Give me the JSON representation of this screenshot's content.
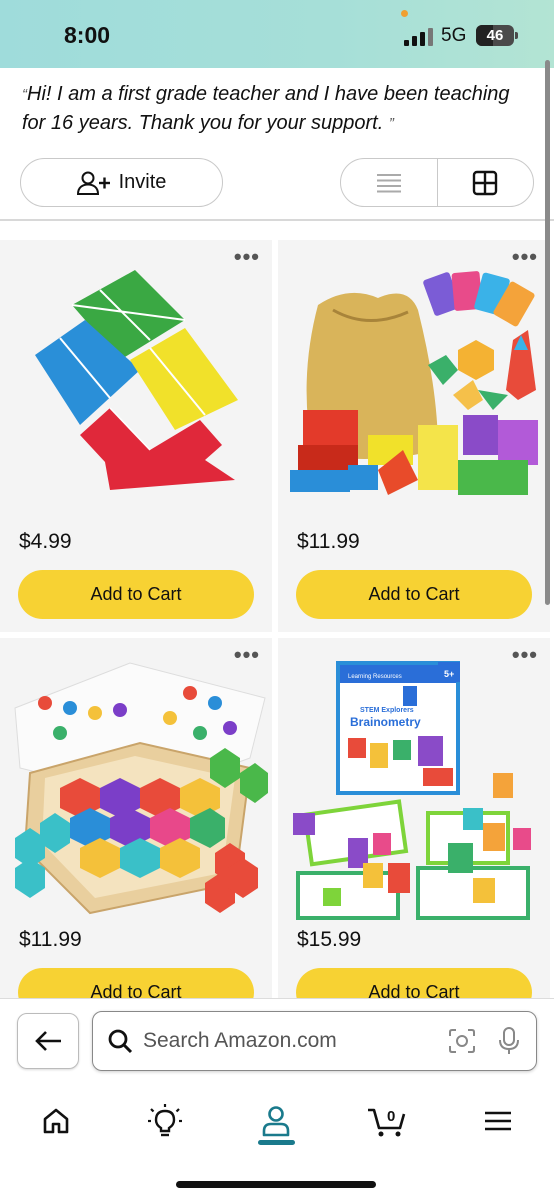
{
  "status_bar": {
    "time": "8:00",
    "network": "5G",
    "battery": "46",
    "battery_level": 0.46
  },
  "quote": {
    "open_mark": "“",
    "text": "Hi! I am a first grade teacher and I have been teaching for 16 years. Thank you for your support.",
    "close_mark": "”"
  },
  "invite": {
    "label": "Invite"
  },
  "view_toggle": {
    "options": [
      "list",
      "grid"
    ],
    "selected": "grid"
  },
  "products": [
    {
      "price": "$4.99",
      "button": "Add to Cart",
      "image_icon": "tangram-puzzle-image"
    },
    {
      "price": "$11.99",
      "button": "Add to Cart",
      "image_icon": "pattern-blocks-image"
    },
    {
      "price": "$11.99",
      "button": "Add to Cart",
      "image_icon": "hexagon-puzzle-image"
    },
    {
      "price": "$15.99",
      "button": "Add to Cart",
      "image_icon": "brainometry-kit-image",
      "box_text": {
        "brand": "Learning Resources",
        "title_small": "STEM Explorers",
        "title": "Brainometry",
        "age": "5+"
      }
    }
  ],
  "search": {
    "placeholder": "Search Amazon.com"
  },
  "bottom_nav": {
    "items": [
      "home-icon",
      "lightbulb-icon",
      "account-icon",
      "cart-icon",
      "menu-icon"
    ],
    "active": "account-icon",
    "cart_count": "0"
  },
  "colors": {
    "accent": "#1a7a8c",
    "add_to_cart": "#f7d233",
    "status_bar": "#a6dfd8"
  }
}
